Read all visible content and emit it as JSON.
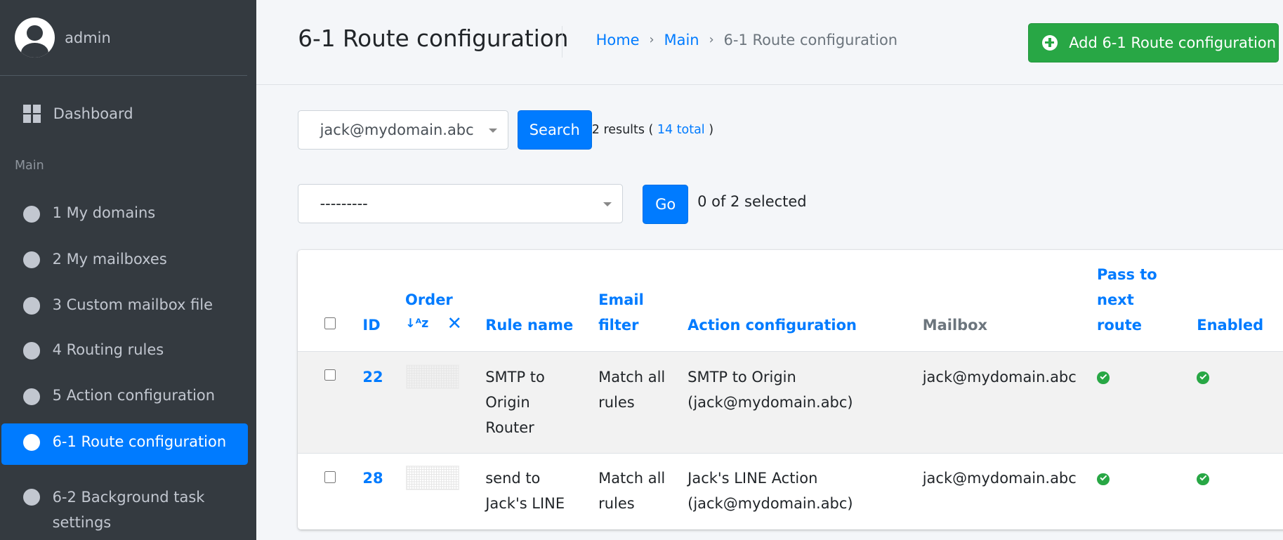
{
  "sidebar": {
    "user": "admin",
    "dashboard": "Dashboard",
    "section_header": "Main",
    "items": [
      {
        "label": "1 My domains"
      },
      {
        "label": "2 My mailboxes"
      },
      {
        "label": "3 Custom mailbox file"
      },
      {
        "label": "4 Routing rules"
      },
      {
        "label": "5 Action configuration"
      },
      {
        "label": "6-1 Route configuration"
      },
      {
        "label": "6-2 Background task settings"
      }
    ]
  },
  "header": {
    "title": "6-1 Route configuration",
    "breadcrumb": [
      "Home",
      "Main",
      "6-1 Route configuration"
    ],
    "add_button": "Add 6-1 Route configuration"
  },
  "search": {
    "selected": "jack@mydomain.abc",
    "button": "Search",
    "results_prefix": "2 results (",
    "total_link": "14 total",
    "results_suffix": ")"
  },
  "actions": {
    "selected": "---------",
    "go_button": "Go",
    "selected_count": "0 of 2 selected"
  },
  "table": {
    "headers": {
      "id": "ID",
      "order": "Order",
      "sort_symbol": "↓a z",
      "rule_name": "Rule name",
      "email_filter": "Email filter",
      "action_configuration": "Action configuration",
      "mailbox": "Mailbox",
      "pass_to_next_route": "Pass to next route",
      "enabled": "Enabled"
    },
    "rows": [
      {
        "id": "22",
        "rule_name": "SMTP to Origin Router",
        "email_filter": "Match all rules",
        "action_configuration": "SMTP to Origin (jack@mydomain.abc)",
        "mailbox": "jack@mydomain.abc",
        "pass_to_next_route": true,
        "enabled": true
      },
      {
        "id": "28",
        "rule_name": "send to Jack's LINE",
        "email_filter": "Match all rules",
        "action_configuration": "Jack's LINE Action (jack@mydomain.abc)",
        "mailbox": "jack@mydomain.abc",
        "pass_to_next_route": true,
        "enabled": true
      }
    ]
  },
  "colors": {
    "primary": "#007bff",
    "success": "#28a745",
    "sidebar_bg": "#343a40",
    "row_hover": "#f2f2f2"
  }
}
